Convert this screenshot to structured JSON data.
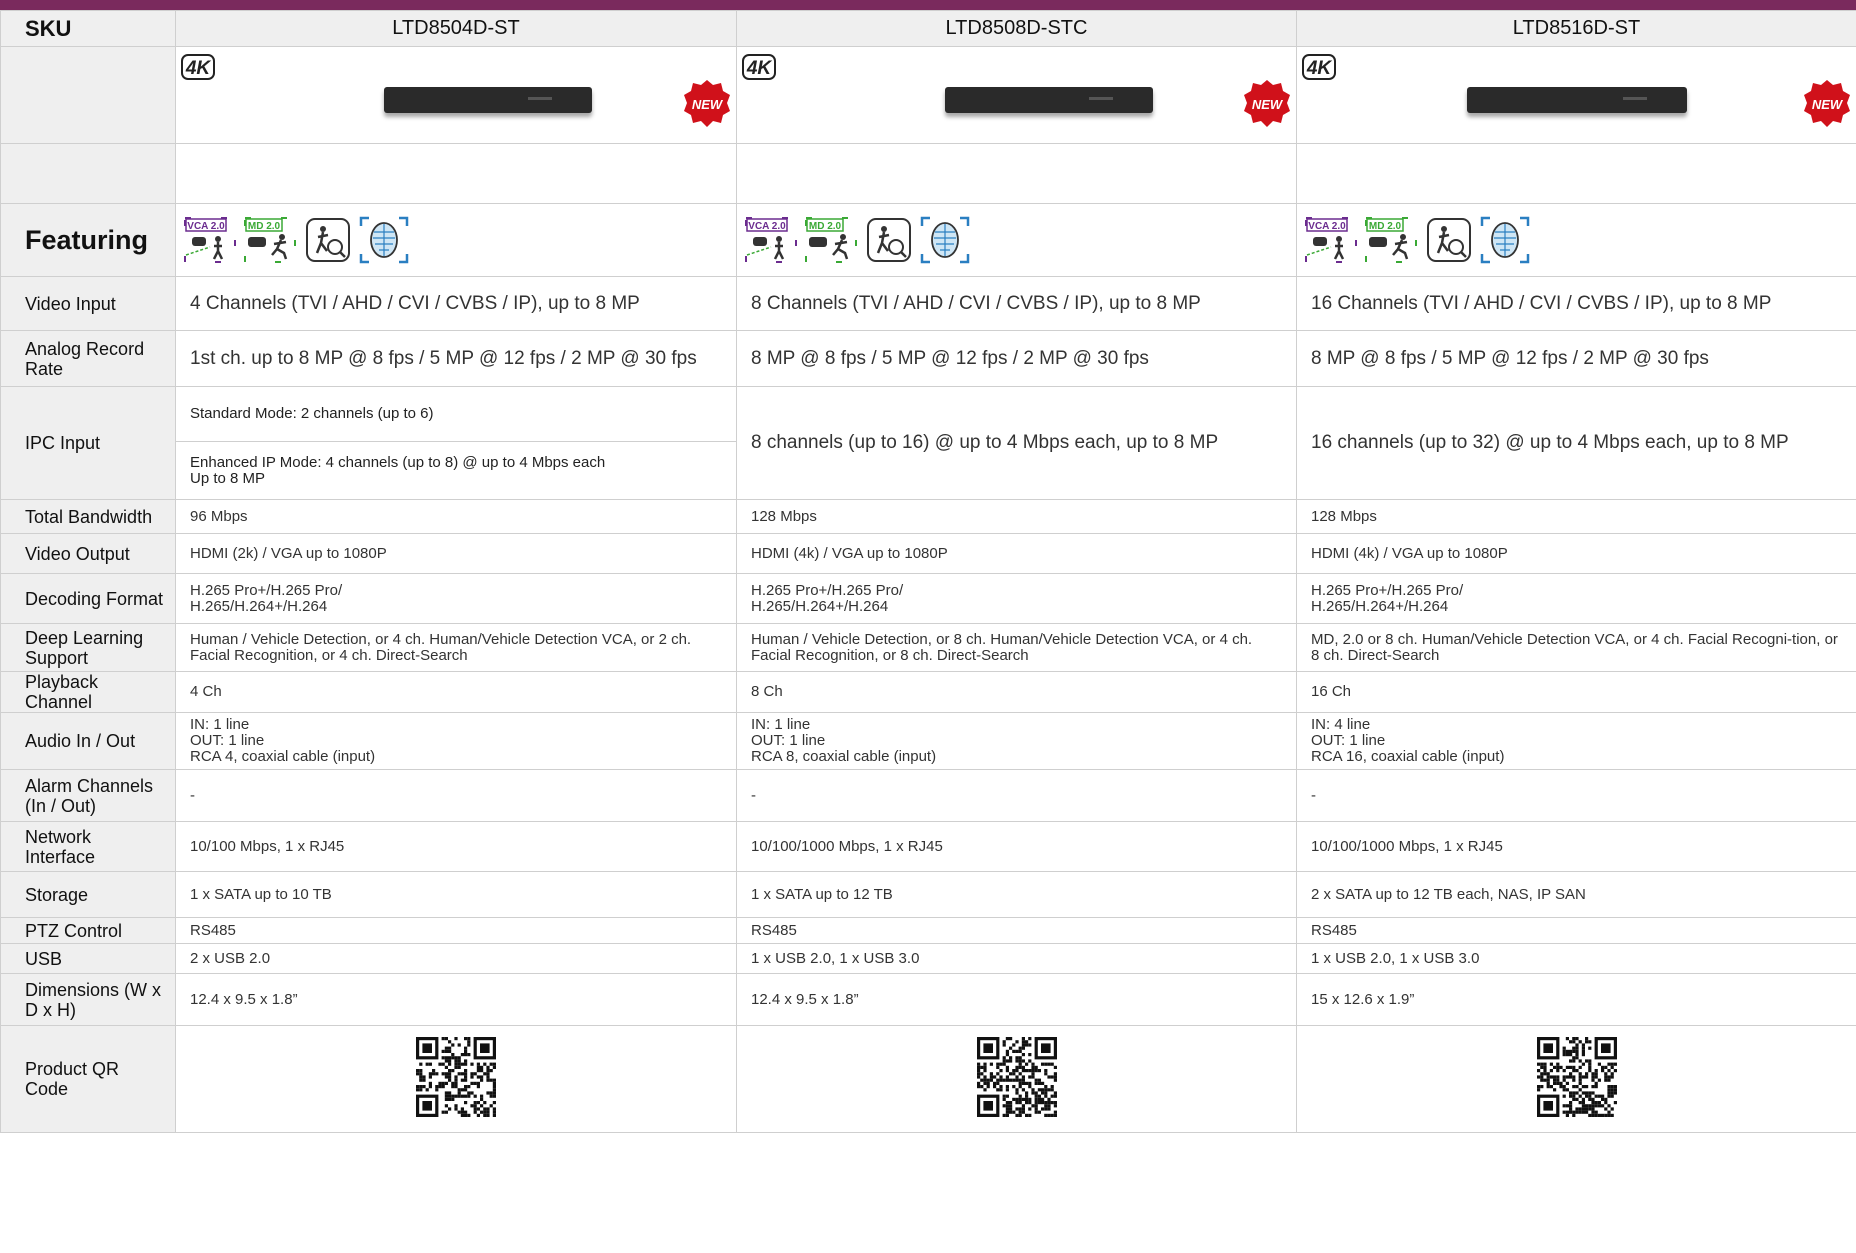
{
  "header": {
    "sku_label": "SKU",
    "skus": [
      "LTD8504D-ST",
      "LTD8508D-STC",
      "LTD8516D-ST"
    ]
  },
  "badges": {
    "resolution": "4K",
    "new": "NEW"
  },
  "featuring": {
    "label": "Featuring",
    "icons": [
      "vca-2.0-icon",
      "md-2.0-icon",
      "direct-search-icon",
      "facial-recognition-icon"
    ],
    "vca_text": "VCA 2.0",
    "md_text": "MD 2.0"
  },
  "rows": {
    "video_input": {
      "label": "Video Input",
      "values": [
        "4 Channels (TVI / AHD / CVI / CVBS / IP), up to 8 MP",
        "8 Channels (TVI / AHD / CVI / CVBS / IP), up to 8 MP",
        "16 Channels (TVI / AHD / CVI / CVBS / IP), up to 8 MP"
      ]
    },
    "analog_record_rate": {
      "label": "Analog Record Rate",
      "values": [
        "1st ch. up to 8 MP @ 8 fps / 5 MP @ 12 fps / 2 MP @ 30 fps",
        "8 MP @ 8  fps / 5 MP @ 12  fps / 2 MP @ 30 fps",
        "8 MP @ 8  fps / 5 MP @ 12  fps / 2 MP @ 30 fps"
      ]
    },
    "ipc_input": {
      "label": "IPC Input",
      "col1_standard": "Standard Mode: 2 channels (up to 6)",
      "col1_enhanced": "Enhanced IP Mode: 4 channels (up to 8) @ up to 4 Mbps each\nUp to 8 MP",
      "col2": "8 channels (up to 16) @ up to 4 Mbps each, up to 8 MP",
      "col3": "16 channels (up to 32) @ up to 4 Mbps each, up to 8 MP"
    },
    "total_bandwidth": {
      "label": "Total Bandwidth",
      "values": [
        "96 Mbps",
        "128 Mbps",
        "128 Mbps"
      ]
    },
    "video_output": {
      "label": "Video Output",
      "values": [
        "HDMI (2k) / VGA up to 1080P",
        "HDMI (4k) / VGA up to 1080P",
        "HDMI (4k) / VGA up to 1080P"
      ]
    },
    "decoding_format": {
      "label": "Decoding Format",
      "values": [
        "H.265 Pro+/H.265 Pro/\nH.265/H.264+/H.264",
        "H.265 Pro+/H.265 Pro/\nH.265/H.264+/H.264",
        "H.265 Pro+/H.265 Pro/\nH.265/H.264+/H.264"
      ]
    },
    "deep_learning": {
      "label": "Deep Learning Support",
      "values": [
        "Human / Vehicle Detection, or 4 ch. Human/Vehicle Detection VCA, or 2 ch. Facial Recognition, or 4 ch. Direct-Search",
        "Human / Vehicle Detection, or 8 ch. Human/Vehicle Detection VCA, or 4 ch. Facial Recognition, or 8 ch. Direct-Search",
        "MD, 2.0 or 8 ch. Human/Vehicle Detection VCA, or 4 ch. Facial Recogni-tion, or 8 ch. Direct-Search"
      ]
    },
    "playback_channel": {
      "label": "Playback Channel",
      "values": [
        "4 Ch",
        "8 Ch",
        "16 Ch"
      ]
    },
    "audio": {
      "label": "Audio In / Out",
      "values": [
        "IN: 1 line\nOUT: 1 line\nRCA 4, coaxial cable (input)",
        "IN: 1 line\nOUT: 1 line\nRCA 8, coaxial cable (input)",
        "IN: 4 line\nOUT: 1 line\nRCA 16, coaxial cable (input)"
      ]
    },
    "alarm": {
      "label": "Alarm Channels (In / Out)",
      "values": [
        "-",
        "-",
        "-"
      ]
    },
    "network": {
      "label": "Network Interface",
      "values": [
        "10/100 Mbps, 1 x RJ45",
        "10/100/1000 Mbps, 1 x RJ45",
        "10/100/1000 Mbps, 1 x RJ45"
      ]
    },
    "storage": {
      "label": "Storage",
      "values": [
        "1 x SATA up to 10 TB",
        "1 x SATA up to 12 TB",
        "2 x SATA up to 12 TB each, NAS, IP SAN"
      ]
    },
    "ptz": {
      "label": "PTZ Control",
      "values": [
        "RS485",
        "RS485",
        "RS485"
      ]
    },
    "usb": {
      "label": "USB",
      "values": [
        "2 x USB 2.0",
        "1 x USB 2.0, 1 x USB 3.0",
        "1 x USB 2.0, 1 x USB 3.0"
      ]
    },
    "dimensions": {
      "label": "Dimensions (W x D x H)",
      "values": [
        "12.4 x 9.5 x 1.8”",
        "12.4 x 9.5 x 1.8”",
        "15 x 12.6 x 1.9”"
      ]
    },
    "qr": {
      "label": "Product QR Code"
    }
  },
  "colors": {
    "accent": "#7a2a5d",
    "new_badge": "#d0111a",
    "vca": "#6b2c8f",
    "md": "#3aa935",
    "face": "#2a7fc1"
  }
}
